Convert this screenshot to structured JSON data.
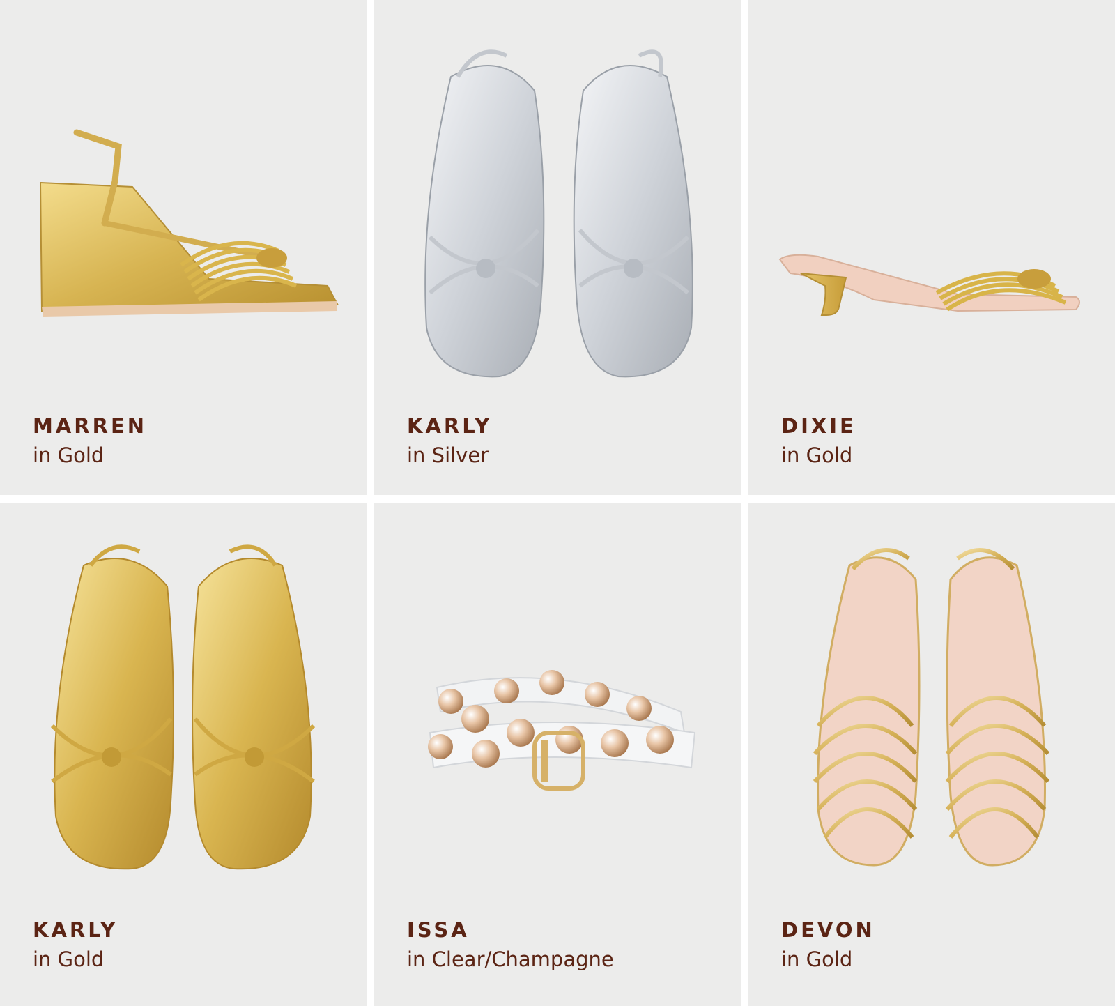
{
  "products": [
    {
      "name": "MARREN",
      "color": "in Gold",
      "image": "gold-wedge-sandal-side-view"
    },
    {
      "name": "KARLY",
      "color": "in Silver",
      "image": "silver-flat-knot-sandals-top-view"
    },
    {
      "name": "DIXIE",
      "color": "in Gold",
      "image": "gold-kitten-heel-mule-side-view"
    },
    {
      "name": "KARLY",
      "color": "in Gold",
      "image": "gold-flat-knot-sandals-top-view"
    },
    {
      "name": "ISSA",
      "color": "in Clear/Champagne",
      "image": "clear-studded-belt"
    },
    {
      "name": "DEVON",
      "color": "in Gold",
      "image": "gold-caged-flat-sandals-top-view"
    }
  ],
  "colors": {
    "tile_background": "#ececeb",
    "text": "#5b2414",
    "gold": "#d8b85a",
    "silver": "#d6d8dc"
  }
}
